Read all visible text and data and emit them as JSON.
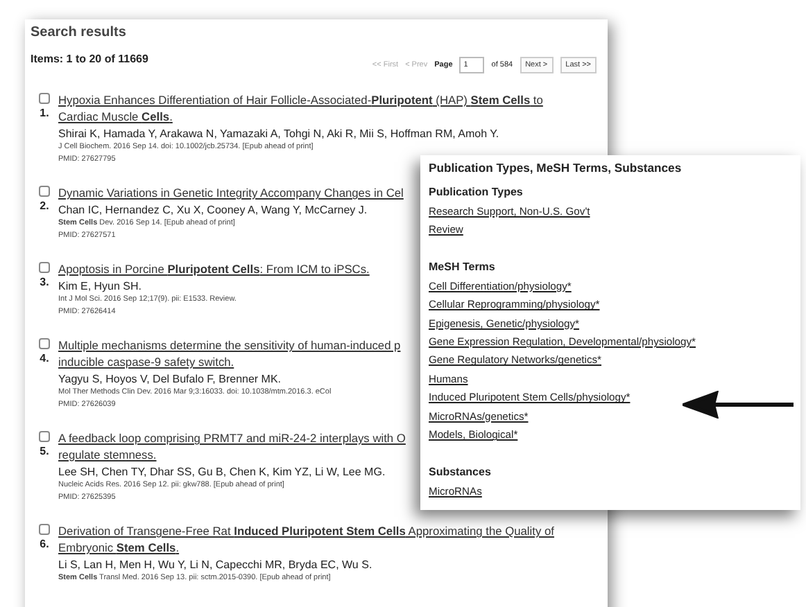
{
  "heading": "Search results",
  "count": "Items: 1 to 20 of 11669",
  "pager": {
    "first": "<< First",
    "prev": "< Prev",
    "page_label": "Page",
    "page": "1",
    "of": "of 584",
    "next": "Next >",
    "last": "Last >>"
  },
  "results": [
    {
      "number": "1.",
      "checked": false,
      "title_lines": [
        "Hypoxia Enhances Differentiation of Hair Follicle-Associated-**Pluripotent** (HAP) **Stem Cells** to",
        "Cardiac Muscle **Cells**."
      ],
      "authors": "Shirai K, Hamada Y, Arakawa N, Yamazaki A, Tohgi N, Aki R, Mii S, Hoffman RM, Amoh Y.",
      "citation": "J Cell Biochem. 2016 Sep 14. doi: 10.1002/jcb.25734. [Epub ahead of print]",
      "pmid": "PMID: 27627795"
    },
    {
      "number": "2.",
      "checked": false,
      "title_lines": [
        "Dynamic Variations in Genetic Integrity Accompany Changes in Cel"
      ],
      "authors": "Chan IC, Hernandez C, Xu X, Cooney A, Wang Y, McCarney J.",
      "citation": "**Stem Cells** Dev. 2016 Sep 14. [Epub ahead of print]",
      "pmid": "PMID: 27627571"
    },
    {
      "number": "3.",
      "checked": false,
      "title_lines": [
        "Apoptosis in Porcine **Pluripotent Cells**: From ICM to iPSCs."
      ],
      "authors": "Kim E, Hyun SH.",
      "citation": "Int J Mol Sci. 2016 Sep 12;17(9). pii: E1533. Review.",
      "pmid": "PMID: 27626414"
    },
    {
      "number": "4.",
      "checked": false,
      "title_lines": [
        "Multiple mechanisms determine the sensitivity of human-induced p",
        "inducible caspase-9 safety switch."
      ],
      "authors": "Yagyu S, Hoyos V, Del Bufalo F, Brenner MK.",
      "citation": "Mol Ther Methods Clin Dev. 2016 Mar 9;3:16033. doi: 10.1038/mtm.2016.3. eCol",
      "pmid": "PMID: 27626039"
    },
    {
      "number": "5.",
      "checked": false,
      "title_lines": [
        "A feedback loop comprising PRMT7 and miR-24-2 interplays with O",
        "regulate stemness."
      ],
      "authors": "Lee SH, Chen TY, Dhar SS, Gu B, Chen K, Kim YZ, Li W, Lee MG.",
      "citation": "Nucleic Acids Res. 2016 Sep 12. pii: gkw788. [Epub ahead of print]",
      "pmid": "PMID: 27625395"
    },
    {
      "number": "6.",
      "checked": false,
      "title_lines": [
        "Derivation of Transgene-Free Rat **Induced Pluripotent Stem Cells** Approximating the Quality of",
        "Embryonic **Stem Cells**."
      ],
      "authors": "Li S, Lan H, Men H, Wu Y, Li N, Capecchi MR, Bryda EC, Wu S.",
      "citation": "**Stem Cells** Transl Med. 2016 Sep 13. pii: sctm.2015-0390. [Epub ahead of print]"
    }
  ],
  "popup": {
    "title": "Publication Types, MeSH Terms, Substances",
    "sections": [
      {
        "heading": "Publication Types",
        "links": [
          "Research Support, Non-U.S. Gov't",
          "Review"
        ]
      },
      {
        "heading": "MeSH Terms",
        "links": [
          "Cell Differentiation/physiology*",
          "Cellular Reprogramming/physiology*",
          "Epigenesis, Genetic/physiology*",
          "Gene Expression Regulation, Developmental/physiology*",
          "Gene Regulatory Networks/genetics*",
          "Humans",
          "Induced Pluripotent Stem Cells/physiology*",
          "MicroRNAs/genetics*",
          "Models, Biological*"
        ]
      },
      {
        "heading": "Substances",
        "links": [
          "MicroRNAs"
        ]
      }
    ]
  }
}
